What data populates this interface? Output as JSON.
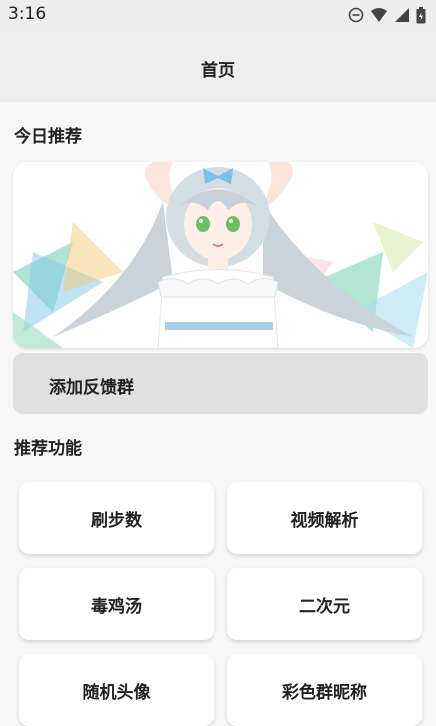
{
  "status_bar": {
    "time": "3:16",
    "icons": [
      "do-not-disturb-icon",
      "wifi-icon",
      "signal-icon",
      "battery-icon"
    ]
  },
  "app_bar": {
    "title": "首页"
  },
  "today": {
    "title": "今日推荐",
    "banner_icon": "anime-girl-illustration"
  },
  "feedback": {
    "label": "添加反馈群"
  },
  "features": {
    "title": "推荐功能",
    "items": [
      {
        "label": "刷步数"
      },
      {
        "label": "视频解析"
      },
      {
        "label": "毒鸡汤"
      },
      {
        "label": "二次元"
      },
      {
        "label": "随机头像"
      },
      {
        "label": "彩色群昵称"
      }
    ]
  }
}
